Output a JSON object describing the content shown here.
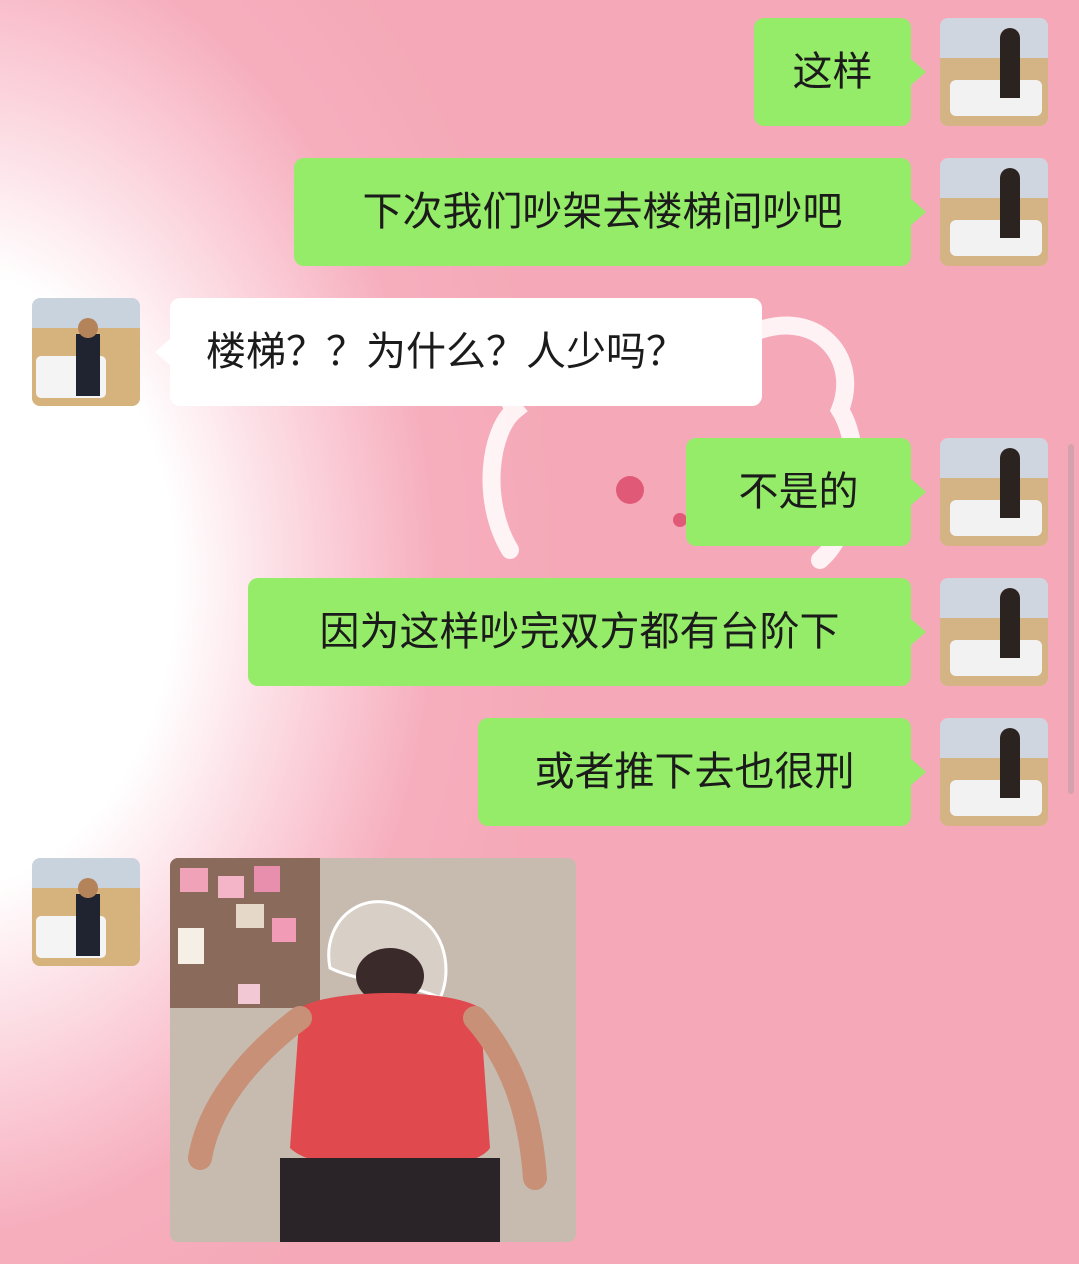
{
  "messages": [
    {
      "side": "right",
      "text": "这样"
    },
    {
      "side": "right",
      "text": "下次我们吵架去楼梯间吵吧"
    },
    {
      "side": "left",
      "text": "楼梯？？为什么？人少吗？"
    },
    {
      "side": "right",
      "text": "不是的"
    },
    {
      "side": "right",
      "text": "因为这样吵完双方都有台阶下"
    },
    {
      "side": "right",
      "text": "或者推下去也很刑"
    },
    {
      "side": "left",
      "type": "image",
      "image": "meme-person-hitting-wall"
    }
  ],
  "colors": {
    "sent_bubble": "#95ec69",
    "received_bubble": "#ffffff",
    "background": "#f5a9b8"
  },
  "icons": {
    "my_avatar": "user-avatar-desert-car",
    "other_avatar": "contact-avatar-desert-car"
  }
}
